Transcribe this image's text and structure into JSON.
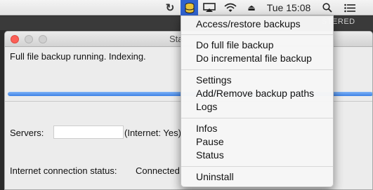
{
  "menubar": {
    "icons": [
      "sync-icon",
      "urbackup-tray-icon",
      "airplay-icon",
      "wifi-icon",
      "eject-icon",
      "spotlight-icon",
      "notification-list-icon"
    ],
    "clock": "Tue 15:08",
    "accent_color": "#2f62cf"
  },
  "background_window": {
    "label": "STERED"
  },
  "status_window": {
    "title": "Sta",
    "status_text": "Full file backup running. Indexing.",
    "progress_fraction": 1.0,
    "servers_label": "Servers:",
    "servers_value": "",
    "servers_suffix": "(Internet: Yes)",
    "internet_status_label": "Internet connection status:",
    "internet_status_value": "Connected"
  },
  "tray_menu": {
    "items": [
      "Access/restore backups",
      "Do full file backup",
      "Do incremental file backup",
      "Settings",
      "Add/Remove backup paths",
      "Logs",
      "Infos",
      "Pause",
      "Status",
      "Uninstall"
    ]
  }
}
